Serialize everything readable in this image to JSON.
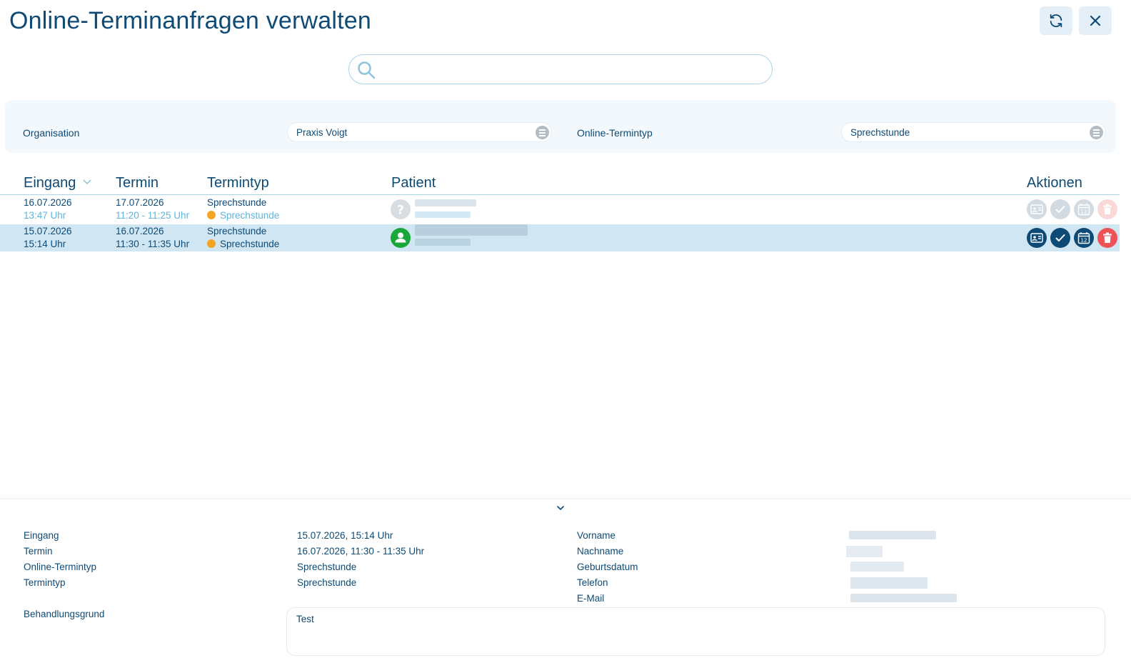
{
  "header": {
    "title": "Online-Terminanfragen verwalten"
  },
  "search": {
    "value": "",
    "placeholder": ""
  },
  "filters": {
    "organisation_label": "Organisation",
    "organisation_value": "Praxis Voigt",
    "type_label": "Online-Termintyp",
    "type_value": "Sprechstunde"
  },
  "table": {
    "columns": [
      "Eingang",
      "Termin",
      "Termintyp",
      "Patient",
      "Aktionen"
    ],
    "rows": [
      {
        "eingang_date": "16.07.2026",
        "eingang_time": "13:47 Uhr",
        "termin_date": "17.07.2026",
        "termin_time": "11:20 - 11:25 Uhr",
        "typ": "Sprechstunde",
        "typ_sub": "Sprechstunde",
        "patient_status": "unknown"
      },
      {
        "eingang_date": "15.07.2026",
        "eingang_time": "15:14 Uhr",
        "termin_date": "16.07.2026",
        "termin_time": "11:30 - 11:35 Uhr",
        "typ": "Sprechstunde",
        "typ_sub": "Sprechstunde",
        "patient_status": "known"
      }
    ]
  },
  "details": {
    "left": [
      {
        "label": "Eingang",
        "value": "15.07.2026, 15:14 Uhr"
      },
      {
        "label": "Termin",
        "value": "16.07.2026, 11:30 - 11:35 Uhr"
      },
      {
        "label": "Online-Termintyp",
        "value": "Sprechstunde"
      },
      {
        "label": "Termintyp",
        "value": "Sprechstunde"
      }
    ],
    "right_labels": [
      "Vorname",
      "Nachname",
      "Geburtsdatum",
      "Telefon",
      "E-Mail"
    ],
    "reason_label": "Behandlungsgrund",
    "reason_value": "Test"
  },
  "colors": {
    "primary": "#0d4a75",
    "accent": "#5fb5da",
    "selected_row": "#d0e6f3",
    "delete": "#ee5257",
    "known_patient": "#1aa73a",
    "type_dot": "#f5a524"
  }
}
